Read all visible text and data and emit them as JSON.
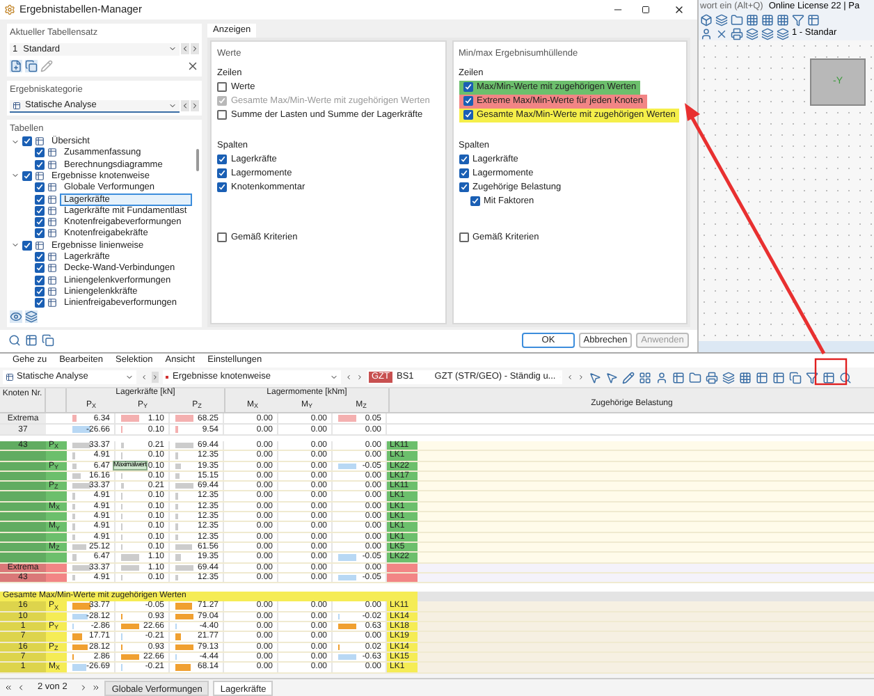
{
  "background_app": {
    "search_hint": "wort ein (Alt+Q)",
    "license": "Online License 22 | Pa",
    "view_selector": "1 - Standar",
    "cube_label": "-Y"
  },
  "dialog": {
    "title": "Ergebnistabellen-Manager",
    "table_set": {
      "title": "Aktueller Tabellensatz",
      "number": "1",
      "value": "Standard"
    },
    "category": {
      "title": "Ergebniskategorie",
      "value": "Statische Analyse"
    },
    "tables": {
      "title": "Tabellen",
      "tree": [
        {
          "label": "Übersicht",
          "checked": true,
          "expanded": true,
          "selected": false,
          "children": [
            {
              "label": "Zusammenfassung",
              "checked": true,
              "selected": false
            },
            {
              "label": "Berechnungsdiagramme",
              "checked": true,
              "selected": false
            }
          ]
        },
        {
          "label": "Ergebnisse knotenweise",
          "checked": true,
          "expanded": true,
          "selected": false,
          "children": [
            {
              "label": "Globale Verformungen",
              "checked": true,
              "selected": false
            },
            {
              "label": "Lagerkräfte",
              "checked": true,
              "selected": true
            },
            {
              "label": "Lagerkräfte mit Fundamentlast",
              "checked": true,
              "selected": false
            },
            {
              "label": "Knotenfreigabeverformungen",
              "checked": true,
              "selected": false
            },
            {
              "label": "Knotenfreigabekräfte",
              "checked": true,
              "selected": false
            }
          ]
        },
        {
          "label": "Ergebnisse linienweise",
          "checked": true,
          "expanded": true,
          "selected": false,
          "children": [
            {
              "label": "Lagerkräfte",
              "checked": true,
              "selected": false
            },
            {
              "label": "Decke-Wand-Verbindungen",
              "checked": true,
              "selected": false
            },
            {
              "label": "Liniengelenkverformungen",
              "checked": true,
              "selected": false
            },
            {
              "label": "Liniengelenkkräfte",
              "checked": true,
              "selected": false
            },
            {
              "label": "Linienfreigabeverformungen",
              "checked": true,
              "selected": false
            }
          ]
        }
      ]
    },
    "tabs": [
      {
        "label": "Anzeigen",
        "selected": true
      }
    ],
    "groups": [
      {
        "title": "Werte",
        "rows_label": "Zeilen",
        "rows": [
          {
            "label": "Werte",
            "checked": false,
            "disabled": false
          },
          {
            "label": "Gesamte Max/Min-Werte mit zugehörigen Werten",
            "checked": true,
            "disabled": true
          },
          {
            "label": "Summe der Lasten und Summe der Lagerkräfte",
            "checked": false,
            "disabled": false
          }
        ],
        "columns_label": "Spalten",
        "columns": [
          {
            "label": "Lagerkräfte",
            "checked": true
          },
          {
            "label": "Lagermomente",
            "checked": true
          },
          {
            "label": "Knotenkommentar",
            "checked": true
          }
        ],
        "criteria": {
          "label": "Gemäß Kriterien",
          "checked": false
        }
      },
      {
        "title": "Min/max Ergebnisumhüllende",
        "rows_label": "Zeilen",
        "rows": [
          {
            "label": "Max/Min-Werte mit zugehörigen Werten",
            "checked": true,
            "disabled": false,
            "color": "#6cbf6c"
          },
          {
            "label": "Extreme Max/Min-Werte für jeden Knoten",
            "checked": true,
            "disabled": false,
            "color": "#f28585"
          },
          {
            "label": "Gesamte Max/Min-Werte mit zugehörigen Werten",
            "checked": true,
            "disabled": false,
            "color": "#f5ef4a"
          }
        ],
        "columns_label": "Spalten",
        "columns": [
          {
            "label": "Lagerkräfte",
            "checked": true
          },
          {
            "label": "Lagermomente",
            "checked": true
          },
          {
            "label": "Zugehörige Belastung",
            "checked": true,
            "children": [
              {
                "label": "Mit Faktoren",
                "checked": true
              }
            ]
          }
        ],
        "criteria": {
          "label": "Gemäß Kriterien",
          "checked": false
        }
      }
    ],
    "buttons": [
      {
        "label": "OK",
        "kind": "default",
        "disabled": false
      },
      {
        "label": "Abbrechen",
        "kind": "normal",
        "disabled": false
      },
      {
        "label": "Anwenden",
        "kind": "normal",
        "disabled": true
      }
    ]
  },
  "results": {
    "menu": [
      "Gehe zu",
      "Bearbeiten",
      "Selektion",
      "Ansicht",
      "Einstellungen"
    ],
    "toolbar": {
      "category": "Statische Analyse",
      "table": "Ergebnisse knotenweise",
      "badge": "GZT",
      "combination": "BS1",
      "combination_name": "GZT (STR/GEO) - Ständig u..."
    },
    "table": {
      "node_header": "Knoten Nr.",
      "groups": [
        {
          "label": "Lagerkräfte [kN]",
          "columns": [
            "P$_{X}$",
            "P$_{Y}$",
            "P$_{Z}$"
          ]
        },
        {
          "label": "Lagermomente [kNm]",
          "columns": [
            "M$_{X}$",
            "M$_{Y}$",
            "M$_{Z}$"
          ]
        }
      ],
      "load_header": "Zugehörige Belastung",
      "extrema_rows": [
        {
          "node": "Extrema",
          "values": [
            "6.34",
            "1.10",
            "68.25",
            "0.00",
            "0.00",
            "0.05"
          ]
        },
        {
          "node": "37",
          "values": [
            "-26.66",
            "0.10",
            "9.54",
            "0.00",
            "0.00",
            "0.00"
          ]
        }
      ],
      "sections": [
        {
          "color": "#6cbf6c",
          "rows": [
            {
              "node": "43",
              "type": "P$_{X}$",
              "values": [
                "33.37",
                "0.21",
                "69.44",
                "0.00",
                "0.00",
                "0.00"
              ],
              "load": "LK11"
            },
            {
              "values": [
                "4.91",
                "0.10",
                "12.35",
                "0.00",
                "0.00",
                "0.00"
              ],
              "load": "LK1"
            },
            {
              "type": "P$_{Y}$",
              "values": [
                "6.47",
                "0.10",
                "19.35",
                "0.00",
                "0.00",
                "-0.05"
              ],
              "load": "LK22"
            },
            {
              "values": [
                "16.16",
                "0.10",
                "15.15",
                "0.00",
                "0.00",
                "0.00"
              ],
              "load": "LK17"
            },
            {
              "type": "P$_{Z}$",
              "values": [
                "33.37",
                "0.21",
                "69.44",
                "0.00",
                "0.00",
                "0.00"
              ],
              "load": "LK11"
            },
            {
              "values": [
                "4.91",
                "0.10",
                "12.35",
                "0.00",
                "0.00",
                "0.00"
              ],
              "load": "LK1"
            },
            {
              "type": "M$_{X}$",
              "values": [
                "4.91",
                "0.10",
                "12.35",
                "0.00",
                "0.00",
                "0.00"
              ],
              "load": "LK1"
            },
            {
              "values": [
                "4.91",
                "0.10",
                "12.35",
                "0.00",
                "0.00",
                "0.00"
              ],
              "load": "LK1"
            },
            {
              "type": "M$_{Y}$",
              "values": [
                "4.91",
                "0.10",
                "12.35",
                "0.00",
                "0.00",
                "0.00"
              ],
              "load": "LK1"
            },
            {
              "values": [
                "4.91",
                "0.10",
                "12.35",
                "0.00",
                "0.00",
                "0.00"
              ],
              "load": "LK1"
            },
            {
              "type": "M$_{Z}$",
              "values": [
                "25.12",
                "0.10",
                "61.56",
                "0.00",
                "0.00",
                "0.00"
              ],
              "load": "LK5"
            },
            {
              "values": [
                "6.47",
                "1.10",
                "19.35",
                "0.00",
                "0.00",
                "-0.05"
              ],
              "load": "LK22"
            }
          ]
        },
        {
          "color": "#f28585",
          "rows": [
            {
              "node": "Extrema",
              "values": [
                "33.37",
                "1.10",
                "69.44",
                "0.00",
                "0.00",
                "0.00"
              ]
            },
            {
              "node": "43",
              "values": [
                "4.91",
                "0.10",
                "12.35",
                "0.00",
                "0.00",
                "-0.05"
              ]
            }
          ]
        },
        {
          "color": "#f5ec55",
          "title": "Gesamte Max/Min-Werte mit zugehörigen Werten",
          "rows": [
            {
              "node": "16",
              "type": "P$_{X}$",
              "values": [
                "33.77",
                "-0.05",
                "71.27",
                "0.00",
                "0.00",
                "0.00"
              ],
              "load": "LK11"
            },
            {
              "node": "10",
              "values": [
                "-28.12",
                "0.93",
                "79.04",
                "0.00",
                "0.00",
                "-0.02"
              ],
              "load": "LK14"
            },
            {
              "node": "1",
              "type": "P$_{Y}$",
              "values": [
                "-2.86",
                "22.66",
                "-4.40",
                "0.00",
                "0.00",
                "0.63"
              ],
              "load": "LK18"
            },
            {
              "node": "7",
              "values": [
                "17.71",
                "-0.21",
                "21.77",
                "0.00",
                "0.00",
                "0.00"
              ],
              "load": "LK19"
            },
            {
              "node": "16",
              "type": "P$_{Z}$",
              "values": [
                "28.12",
                "0.93",
                "79.13",
                "0.00",
                "0.00",
                "0.02"
              ],
              "load": "LK14"
            },
            {
              "node": "7",
              "values": [
                "2.86",
                "22.66",
                "-4.44",
                "0.00",
                "0.00",
                "-0.63"
              ],
              "load": "LK15"
            },
            {
              "node": "1",
              "type": "M$_{X}$",
              "values": [
                "-26.69",
                "-0.21",
                "68.14",
                "0.00",
                "0.00",
                "0.00"
              ],
              "load": "LK1"
            }
          ]
        }
      ]
    },
    "tooltip": "Maximalwert",
    "pager": "2 von 2",
    "sheets": [
      {
        "label": "Globale Verformungen",
        "selected": false
      },
      {
        "label": "Lagerkräfte",
        "selected": true
      }
    ]
  }
}
